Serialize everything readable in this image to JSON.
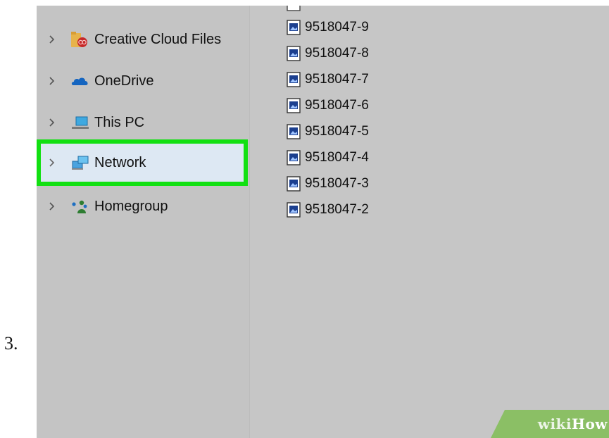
{
  "step": {
    "number": "3."
  },
  "navigation": {
    "items": [
      {
        "label": "Creative Cloud Files",
        "icon": "creative-cloud-folder-icon",
        "selected": false
      },
      {
        "label": "OneDrive",
        "icon": "onedrive-cloud-icon",
        "selected": false
      },
      {
        "label": "This PC",
        "icon": "computer-icon",
        "selected": false
      },
      {
        "label": "Network",
        "icon": "network-icon",
        "selected": true
      },
      {
        "label": "Homegroup",
        "icon": "homegroup-icon",
        "selected": false
      }
    ]
  },
  "files": [
    {
      "name": "9518047-9"
    },
    {
      "name": "9518047-8"
    },
    {
      "name": "9518047-7"
    },
    {
      "name": "9518047-6"
    },
    {
      "name": "9518047-5"
    },
    {
      "name": "9518047-4"
    },
    {
      "name": "9518047-3"
    },
    {
      "name": "9518047-2"
    }
  ],
  "watermark": {
    "part1": "wiki",
    "part2": "How"
  },
  "colors": {
    "highlight_border": "#12e012",
    "selected_background": "#dde8f3",
    "pane_background": "#c4c4c4",
    "watermark_background": "#8bbf65"
  }
}
